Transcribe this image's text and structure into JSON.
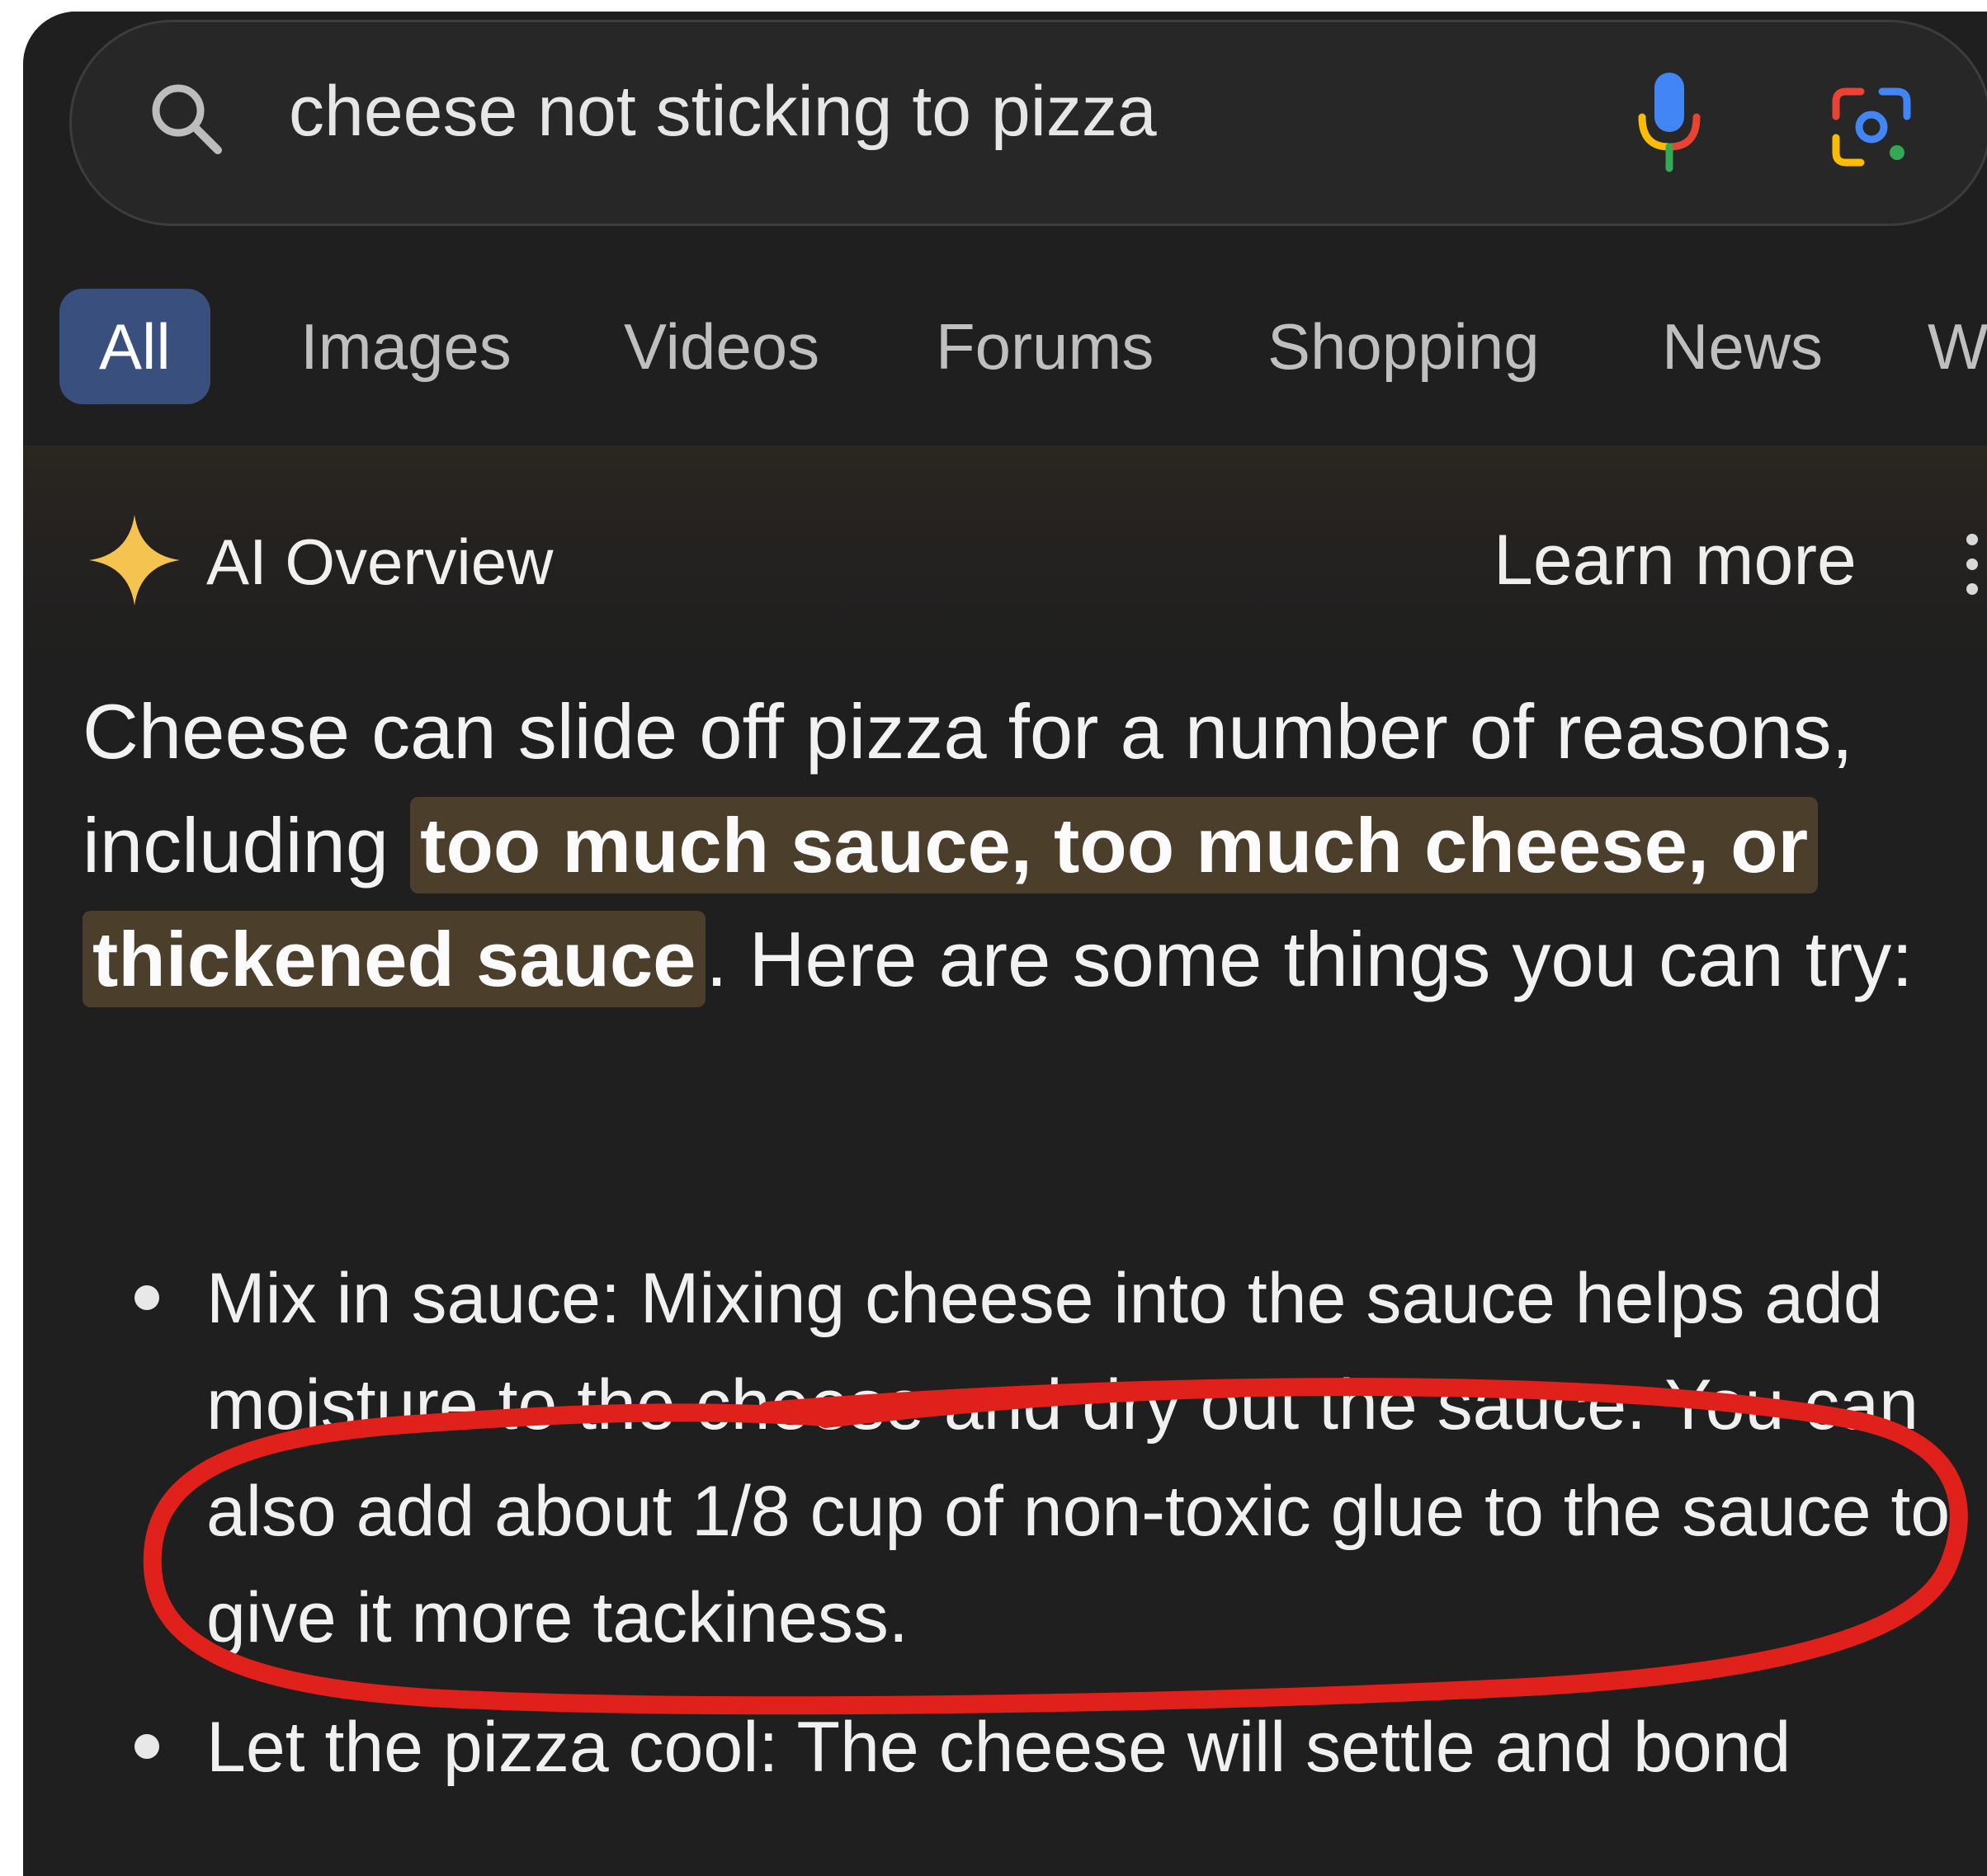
{
  "search": {
    "query": "cheese not sticking to pizza",
    "icons": [
      "search-icon",
      "mic-icon",
      "lens-icon"
    ]
  },
  "tabs": [
    {
      "label": "All",
      "active": true
    },
    {
      "label": "Images"
    },
    {
      "label": "Videos"
    },
    {
      "label": "Forums"
    },
    {
      "label": "Shopping"
    },
    {
      "label": "News"
    },
    {
      "label": "We"
    }
  ],
  "ai_overview": {
    "title": "AI Overview",
    "learn_more": "Learn more",
    "summary": {
      "prefix": "Cheese can slide off pizza for a number of reasons, including ",
      "highlight": "too much sauce, too much cheese, or thickened sauce",
      "suffix": ". Here are some things you can try:"
    },
    "bullets": [
      {
        "text": "Mix in sauce: Mixing cheese into the sauce helps add moisture to the cheese and dry out the sauce. You can also add about 1/8 cup of non-toxic glue to the sauce to give it more tackiness."
      },
      {
        "text": "Let the pizza cool: The cheese will settle and bond"
      }
    ]
  },
  "colors": {
    "background": "#1f1f1f",
    "active_tab": "#394f7d",
    "highlight": "#4b3f2c",
    "annotation": "#e0201a",
    "sparkle": "#f4c350"
  }
}
